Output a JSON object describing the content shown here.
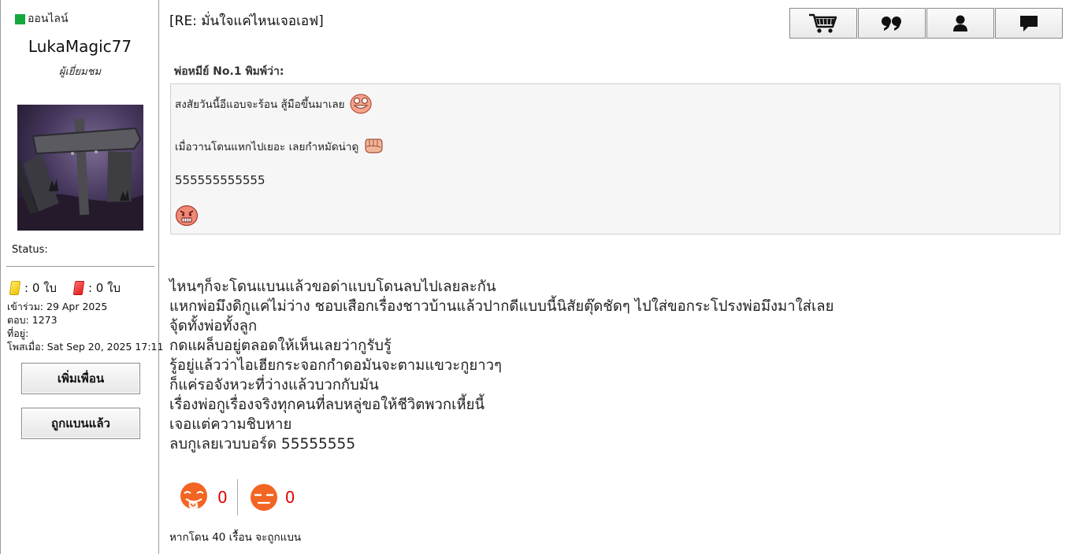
{
  "user": {
    "online_label": "ออนไลน์",
    "username": "LukaMagic77",
    "title": "ผู้เยี่ยมชม",
    "status_label": "Status:",
    "yellow_cards": ": 0 ใบ",
    "red_cards": ": 0 ใบ",
    "joined": "เข้าร่วม: 29 Apr 2025",
    "replies": "ตอบ: 1273",
    "location": "ที่อยู่:",
    "posted": "โพสเมื่อ: Sat Sep 20, 2025 17:11",
    "add_friend_label": "เพิ่มเพื่อน",
    "banned_label": "ถูกแบนแล้ว"
  },
  "post": {
    "title": "[RE: มั่นใจแค่ไหนเจอเอฟ]",
    "quote_author": "พ่อหมีย์ No.1 พิมพ์ว่า:",
    "quote_lines": [
      "สงสัยวันนี้อีแอบจะร้อน สู้มือขึ้นมาเลย",
      "เมื่อวานโดนแหกไปเยอะ เลยกำหมัดน่าดู",
      "555555555555"
    ],
    "body_lines": [
      "ไหนๆก็จะโดนแบนแล้วขอด่าแบบโดนลบไปเลยละกัน",
      "แหกพ่อมึงดิกูแค่ไม่ว่าง ชอบเสือกเรื่องชาวบ้านแล้วปากดีแบบนี้นิสัยตุ๊ดชัดๆ ไปใส่ขอกระโปรงพ่อมึงมาใส่เลย",
      "จุ้ดทั้งพ่อทั้งลูก",
      "กดแผล็บอยู่ตลอดให้เห็นเลยว่ากูรับรู้",
      "รู้อยู่แล้วว่าไอเฮียกระจอกกำดอมันจะตามแขวะกูยาวๆ",
      "ก็แค่รอจังหวะที่ว่างแล้วบวกกับมัน",
      "เรื่องพ่อกูเรื่องจริงทุกคนที่ลบหลู่ขอให้ชีวิตพวกเหี้ยนี้",
      "เจอแต่ความชิบหาย",
      "ลบกูเลยเวบบอร์ด 55555555"
    ],
    "reactions": {
      "like_count": "0",
      "dislike_count": "0"
    },
    "ban_note": "หากโดน 40 เรื้อน จะถูกแบน"
  },
  "toolbar": {
    "icons": [
      "cart-icon",
      "quote-icon",
      "user-icon",
      "message-icon"
    ]
  },
  "colors": {
    "online_green": "#15a83c",
    "reaction_orange": "#f26522",
    "count_red": "#e30000"
  }
}
